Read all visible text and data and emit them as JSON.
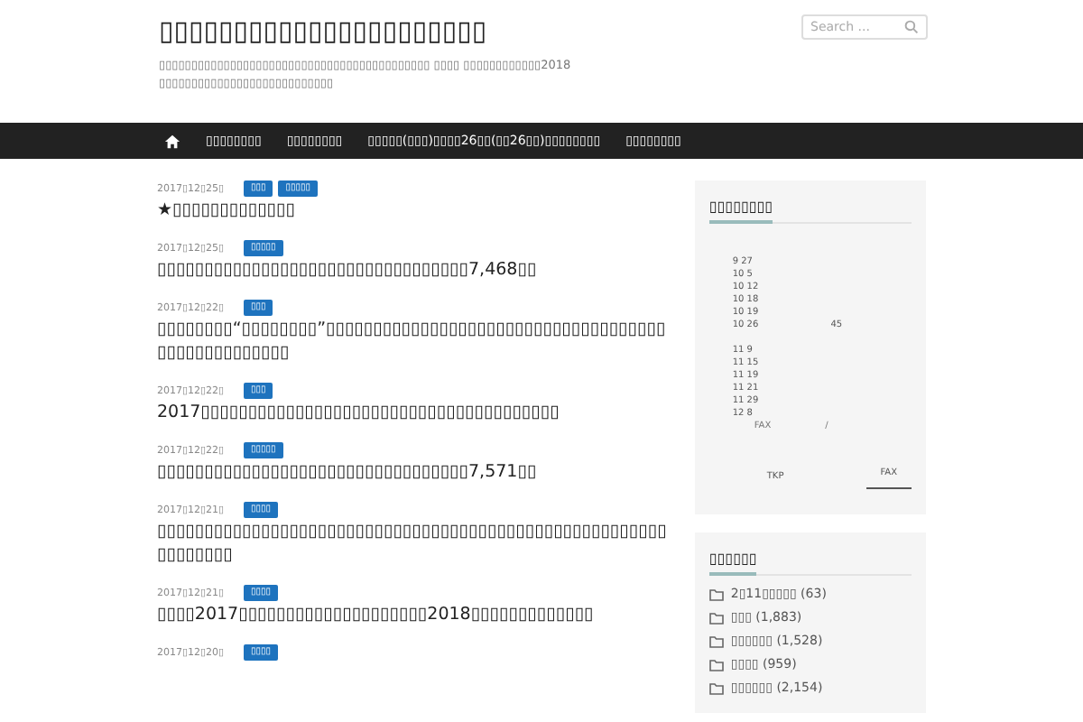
{
  "site": {
    "title": "▯▯▯▯▯▯▯▯▯▯▯▯▯▯▯▯▯▯▯▯▯▯",
    "description": "▯▯▯▯▯▯▯▯▯▯▯▯▯▯▯▯▯▯▯▯▯▯▯▯▯▯▯▯▯▯▯▯▯▯▯▯▯▯▯▯▯▯ ▯▯▯▯ ▯▯▯▯▯▯▯▯▯▯▯▯2018▯▯▯▯▯▯▯▯▯▯▯▯▯▯▯▯▯▯▯▯▯▯▯▯▯▯▯"
  },
  "search": {
    "placeholder": "Search ..."
  },
  "nav": [
    "▯▯▯▯▯▯▯▯",
    "▯▯▯▯▯▯▯▯",
    "▯▯▯▯▯(▯▯▯)▯▯▯▯26▯▯(▯▯26▯▯)▯▯▯▯▯▯▯▯",
    "▯▯▯▯▯▯▯▯"
  ],
  "posts": [
    {
      "date": "2017▯12▯25▯",
      "tags": [
        "▯▯▯",
        "▯▯▯▯▯"
      ],
      "title": "★▯▯▯▯▯▯▯▯▯▯▯▯▯"
    },
    {
      "date": "2017▯12▯25▯",
      "tags": [
        "▯▯▯▯▯"
      ],
      "title": "▯▯▯▯▯▯▯▯▯▯▯▯▯▯▯▯▯▯▯▯▯▯▯▯▯▯▯▯▯▯▯▯▯7,468▯▯"
    },
    {
      "date": "2017▯12▯22▯",
      "tags": [
        "▯▯▯"
      ],
      "title": "▯▯▯▯▯▯▯▯“▯▯▯▯▯▯▯▯”▯▯▯▯▯▯▯▯▯▯▯▯▯▯▯▯▯▯▯▯▯▯▯▯▯▯▯▯▯▯▯▯▯▯▯▯▯▯▯▯▯▯▯▯▯▯▯▯▯▯"
    },
    {
      "date": "2017▯12▯22▯",
      "tags": [
        "▯▯▯"
      ],
      "title": "2017▯▯▯▯▯▯▯▯▯▯▯▯▯▯▯▯▯▯▯▯▯▯▯▯▯▯▯▯▯▯▯▯▯▯▯▯▯▯"
    },
    {
      "date": "2017▯12▯22▯",
      "tags": [
        "▯▯▯▯▯"
      ],
      "title": "▯▯▯▯▯▯▯▯▯▯▯▯▯▯▯▯▯▯▯▯▯▯▯▯▯▯▯▯▯▯▯▯▯7,571▯▯"
    },
    {
      "date": "2017▯12▯21▯",
      "tags": [
        "▯▯▯▯"
      ],
      "title": "▯▯▯▯▯▯▯▯▯▯▯▯▯▯▯▯▯▯▯▯▯▯▯▯▯▯▯▯▯▯▯▯▯▯▯▯▯▯▯▯▯▯▯▯▯▯▯▯▯▯▯▯▯▯▯▯▯▯▯▯▯▯"
    },
    {
      "date": "2017▯12▯21▯",
      "tags": [
        "▯▯▯▯"
      ],
      "title": "▯▯▯▯2017▯▯▯▯▯▯▯▯▯▯▯▯▯▯▯▯▯▯▯▯2018▯▯▯▯▯▯▯▯▯▯▯▯▯"
    },
    {
      "date": "2017▯12▯20▯",
      "tags": [
        "▯▯▯▯"
      ]
    }
  ],
  "schedule_widget": {
    "title": "▯▯▯▯▯▯▯▯",
    "lines": [
      {
        "date": "9 27"
      },
      {
        "date": "10 5"
      },
      {
        "date": "10 12"
      },
      {
        "date": "10 18"
      },
      {
        "date": "10 19"
      },
      {
        "date": "10 26",
        "note": "45"
      },
      {
        "date": "11 9"
      },
      {
        "date": "11 15"
      },
      {
        "date": "11 19"
      },
      {
        "date": "11 21"
      },
      {
        "date": "11 29"
      },
      {
        "date": "12 8"
      }
    ],
    "fax_line": [
      "FAX",
      "/"
    ],
    "footer_left": "TKP",
    "footer_right": "FAX"
  },
  "categories_widget": {
    "title": "▯▯▯▯▯▯",
    "items": [
      "2▯11▯▯▯▯▯ (63)",
      "▯▯▯ (1,883)",
      "▯▯▯▯▯▯ (1,528)",
      "▯▯▯▯ (959)",
      "▯▯▯▯▯▯ (2,154)"
    ]
  }
}
